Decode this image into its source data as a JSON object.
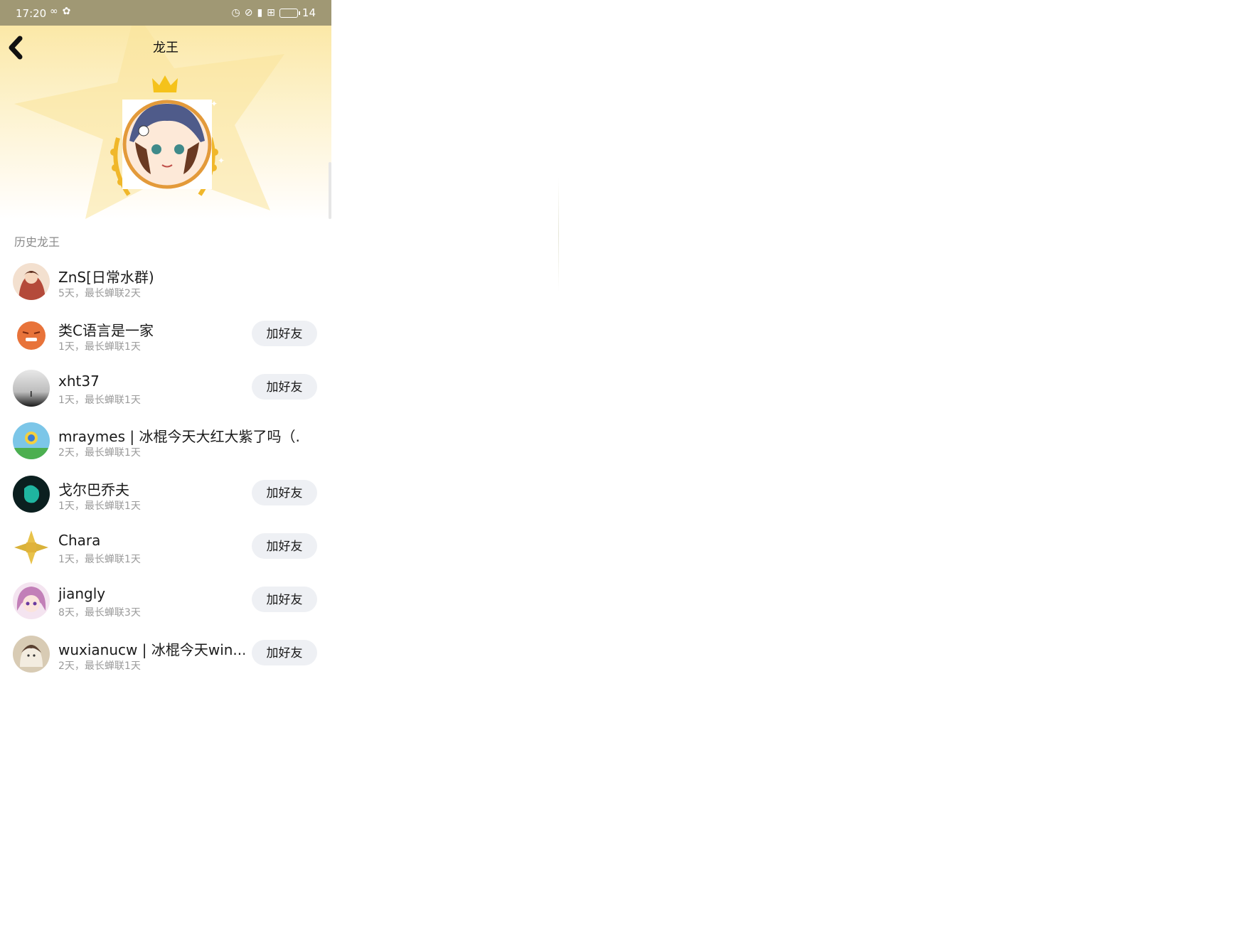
{
  "status_bar": {
    "time": "17:20",
    "battery_level": "14",
    "left_icons": [
      "infinity-icon",
      "app-icon"
    ],
    "right_icons": [
      "alarm-icon",
      "mute-icon",
      "signal-icon",
      "hd-icon",
      "battery-icon"
    ],
    "background": "#a09874"
  },
  "header": {
    "title": "龙王",
    "back_icon": "chevron-left-icon",
    "banner_color": "#fbe8a7",
    "crown_color": "#f5c21b"
  },
  "history": {
    "label": "历史龙王",
    "add_label": "加好友",
    "items": [
      {
        "name": "ZnS[日常水群)",
        "meta": "5天，最长蝉联2天",
        "avatar_color": "#b44a3a",
        "show_add": false
      },
      {
        "name": "类C语言是一家",
        "meta": "1天，最长蝉联1天",
        "avatar_color": "#e8733a",
        "show_add": true
      },
      {
        "name": "xht37",
        "meta": "1天，最长蝉联1天",
        "avatar_color": "#8f8f8f",
        "show_add": true
      },
      {
        "name": "mraymes | 冰棍今天大红大紫了吗（...",
        "meta": "2天，最长蝉联1天",
        "avatar_color": "#4a90c8",
        "show_add": false
      },
      {
        "name": "戈尔巴乔夫",
        "meta": "1天，最长蝉联1天",
        "avatar_color": "#0b1f1f",
        "show_add": true
      },
      {
        "name": "Chara",
        "meta": "1天，最长蝉联1天",
        "avatar_color": "#e0b33a",
        "show_add": true
      },
      {
        "name": "jiangly",
        "meta": "8天，最长蝉联3天",
        "avatar_color": "#c27fb8",
        "show_add": true
      },
      {
        "name": "wuxianucw | 冰棍今天win...",
        "meta": "2天，最长蝉联1天",
        "avatar_color": "#c9b89e",
        "show_add": true
      }
    ]
  }
}
